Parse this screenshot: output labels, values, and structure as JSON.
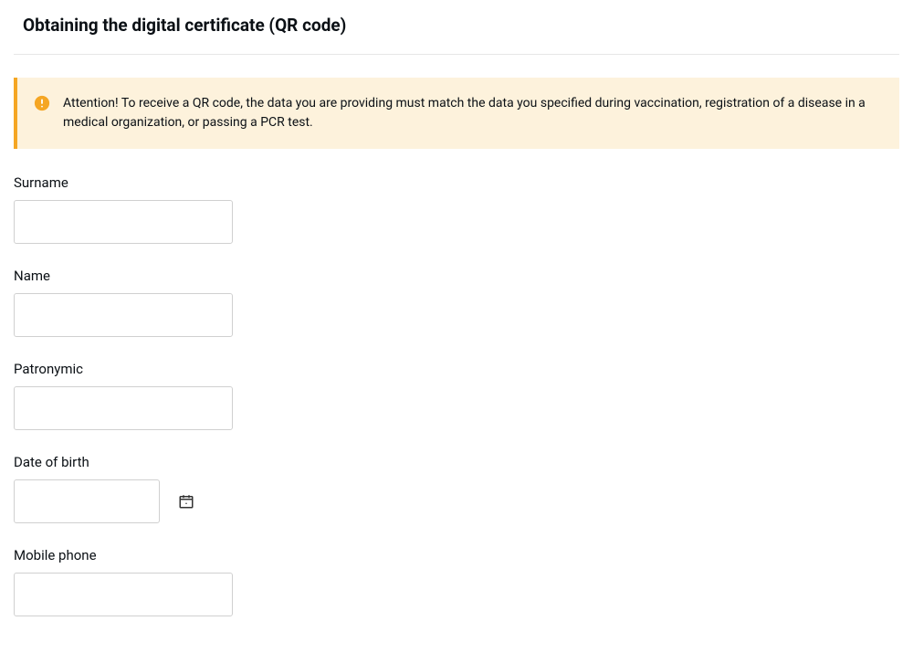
{
  "title": "Obtaining the digital certificate (QR code)",
  "alert": {
    "text": "Attention! To receive a QR code, the data you are providing must match the data you specified during vaccination, registration of a disease in a medical organization, or passing a PCR test."
  },
  "fields": {
    "surname": {
      "label": "Surname",
      "value": ""
    },
    "name": {
      "label": "Name",
      "value": ""
    },
    "patronymic": {
      "label": "Patronymic",
      "value": ""
    },
    "dob": {
      "label": "Date of birth",
      "value": ""
    },
    "phone": {
      "label": "Mobile phone",
      "value": ""
    }
  }
}
